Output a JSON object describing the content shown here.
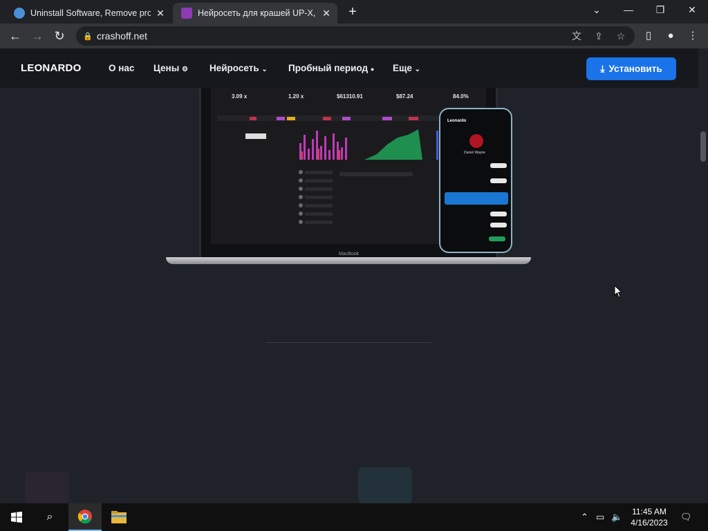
{
  "browser": {
    "tabs": [
      {
        "title": "Uninstall Software, Remove prog",
        "active": false
      },
      {
        "title": "Нейросеть для крашей UP-X, CS",
        "active": true
      }
    ],
    "url": "crashoff.net"
  },
  "site": {
    "logo": "LEONARDO",
    "nav": [
      {
        "label": "О нас"
      },
      {
        "label": "Цены"
      },
      {
        "label": "Нейросеть"
      },
      {
        "label": "Пробный период"
      },
      {
        "label": "Еще"
      }
    ],
    "install_label": "Установить",
    "laptop_stats": [
      "3.09 x",
      "1.20 x",
      "$61310.91",
      "$87.24",
      "84.0%"
    ],
    "laptop_brand": "MacBook",
    "phone_title": "Leonardo",
    "phone_user": "Daniel Wayne"
  },
  "taskbar": {
    "time": "11:45 AM",
    "date": "4/16/2023"
  },
  "colors": {
    "accent": "#1a73e8",
    "page_bg": "#1f2329",
    "nav_bg": "#16181d"
  }
}
